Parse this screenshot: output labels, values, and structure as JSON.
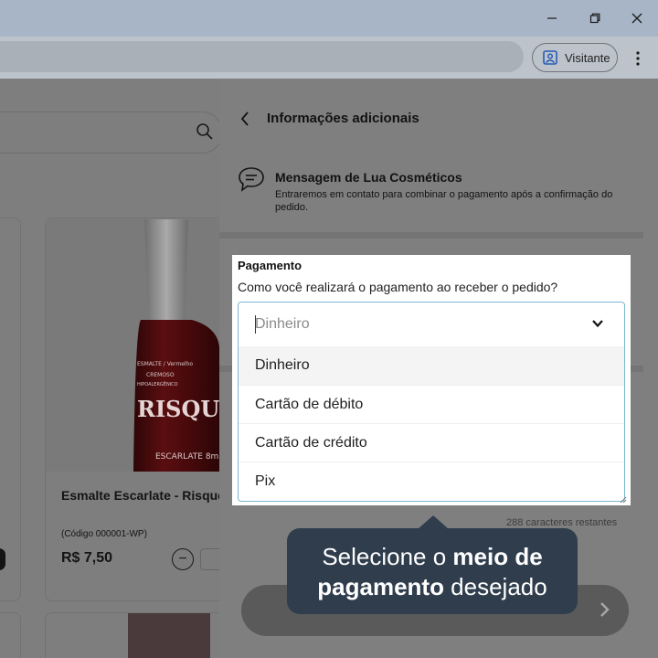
{
  "browser": {
    "profile_label": "Visitante"
  },
  "product": {
    "brand_label": "RISQUÉ",
    "name": "Esmalte Escarlate - Risque",
    "code": "(Código 000001-WP)",
    "price": "R$ 7,50",
    "decrease_symbol": "−"
  },
  "panel": {
    "title": "Informações adicionais",
    "message": {
      "title": "Mensagem de Lua Cosméticos",
      "text": "Entraremos em contato para combinar o pagamento após a confirmação do pedido."
    },
    "payment": {
      "label": "Pagamento",
      "question": "Como você realizará o pagamento ao receber o pedido?",
      "selected": "Dinheiro",
      "options": [
        "Dinheiro",
        "Cartão de débito",
        "Cartão de crédito",
        "Pix"
      ]
    },
    "char_count": "288 caracteres restantes"
  },
  "tooltip": {
    "part1": "Selecione o ",
    "bold": "meio de pagamento",
    "part2": " desejado"
  }
}
